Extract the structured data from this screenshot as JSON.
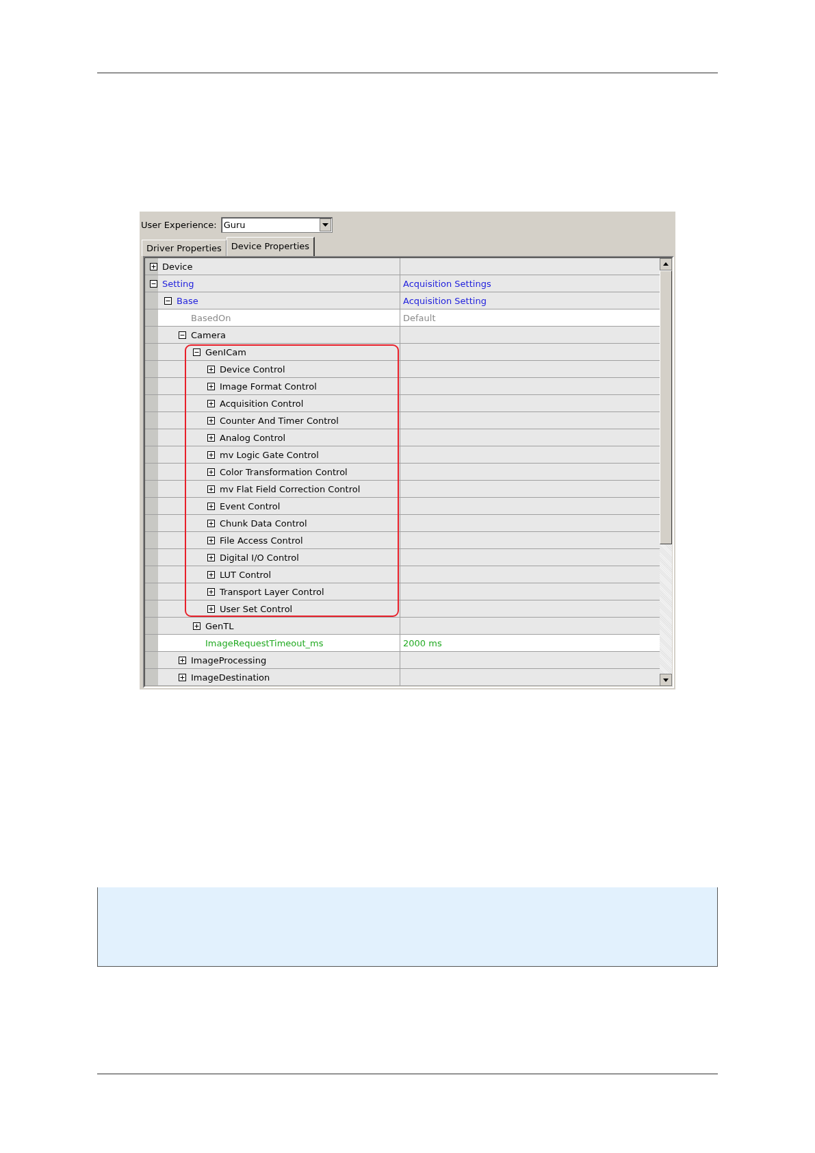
{
  "user_experience": {
    "label": "User Experience:",
    "value": "Guru"
  },
  "tabs": [
    {
      "label": "Driver Properties",
      "selected": false
    },
    {
      "label": "Device Properties",
      "selected": true
    }
  ],
  "tree": [
    {
      "name": "Device",
      "expanded": false
    },
    {
      "name": "Setting",
      "value": "Acquisition Settings",
      "kind": "link",
      "expanded": true,
      "children": [
        {
          "name": "Base",
          "value": "Acquisition Setting",
          "kind": "link",
          "expanded": true,
          "children": [
            {
              "name": "BasedOn",
              "value": "Default",
              "kind": "inactive"
            },
            {
              "name": "Camera",
              "expanded": true,
              "children": [
                {
                  "name": "GenICam",
                  "expanded": true,
                  "highlighted": true,
                  "children": [
                    {
                      "name": "Device Control",
                      "expanded": false
                    },
                    {
                      "name": "Image Format Control",
                      "expanded": false
                    },
                    {
                      "name": "Acquisition Control",
                      "expanded": false
                    },
                    {
                      "name": "Counter And Timer Control",
                      "expanded": false
                    },
                    {
                      "name": "Analog Control",
                      "expanded": false
                    },
                    {
                      "name": "mv Logic Gate Control",
                      "expanded": false
                    },
                    {
                      "name": "Color Transformation Control",
                      "expanded": false
                    },
                    {
                      "name": "mv Flat Field Correction Control",
                      "expanded": false
                    },
                    {
                      "name": "Event Control",
                      "expanded": false
                    },
                    {
                      "name": "Chunk Data Control",
                      "expanded": false
                    },
                    {
                      "name": "File Access Control",
                      "expanded": false
                    },
                    {
                      "name": "Digital I/O Control",
                      "expanded": false
                    },
                    {
                      "name": "LUT Control",
                      "expanded": false
                    },
                    {
                      "name": "Transport Layer Control",
                      "expanded": false
                    },
                    {
                      "name": "User Set Control",
                      "expanded": false
                    }
                  ]
                },
                {
                  "name": "GenTL",
                  "expanded": false
                },
                {
                  "name": "ImageRequestTimeout_ms",
                  "value": "2000 ms",
                  "kind": "modified"
                }
              ]
            },
            {
              "name": "ImageProcessing",
              "expanded": false
            },
            {
              "name": "ImageDestination",
              "expanded": false
            }
          ]
        }
      ]
    }
  ]
}
